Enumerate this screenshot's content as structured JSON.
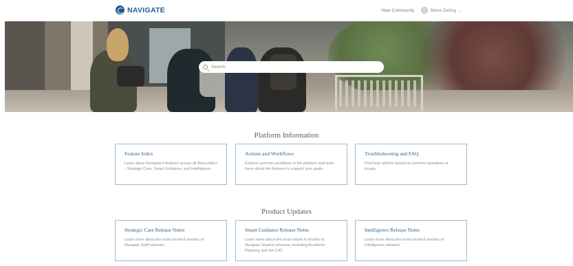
{
  "header": {
    "logo_text": "NAVIGATE",
    "community_link": "New Community",
    "user_name": "Steve Zeiling",
    "brand_color": "#1f5a8f"
  },
  "search": {
    "placeholder": "Search"
  },
  "platform_info": {
    "title": "Platform Information",
    "cards": [
      {
        "title": "Feature Index",
        "description": "Learn about Navigate's features across all three pillars - Strategic Care, Smart Guidance, and Intelligence."
      },
      {
        "title": "Actions and Workflows",
        "description": "Explore common workflows in the platform and learn more about the features to support your goals."
      },
      {
        "title": "Troubleshooting and FAQ",
        "description": "Find help articles based on common questions or issues."
      }
    ]
  },
  "product_updates": {
    "title": "Product Updates",
    "cards": [
      {
        "title": "Strategic Care Release Notes",
        "description": "Learn more about the most recent 6 months of Navigate Staff releases."
      },
      {
        "title": "Smart Guidance Release Notes",
        "description": "Learn more about the most recent 6 months of Navigate Student releases, including Academic Planning and the CAT."
      },
      {
        "title": "Intelligence Release Notes",
        "description": "Learn more about the most recent 6 months of Intelligence releases."
      }
    ]
  }
}
